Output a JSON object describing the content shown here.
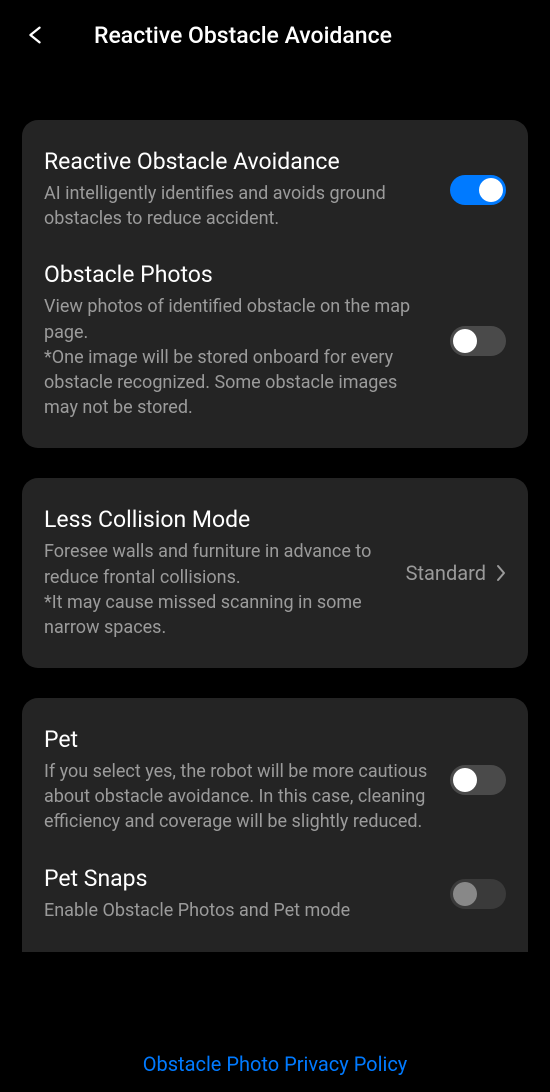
{
  "header": {
    "title": "Reactive Obstacle Avoidance"
  },
  "sections": {
    "reactive": {
      "title": "Reactive Obstacle Avoidance",
      "desc": "AI intelligently identifies and avoids ground obstacles to reduce accident.",
      "enabled": true
    },
    "obstaclePhotos": {
      "title": "Obstacle Photos",
      "desc": "View photos of identified obstacle on the map page.\n*One image will be stored onboard for every obstacle recognized. Some obstacle images may not be stored.",
      "enabled": false
    },
    "lessCollision": {
      "title": "Less Collision Mode",
      "desc": "Foresee walls and furniture in advance to reduce frontal collisions.\n*It may cause missed scanning in some narrow spaces.",
      "value": "Standard"
    },
    "pet": {
      "title": "Pet",
      "desc": "If you select yes, the robot will be more cautious about obstacle avoidance. In this case, cleaning efficiency and coverage will be slightly reduced.",
      "enabled": false
    },
    "petSnaps": {
      "title": "Pet Snaps",
      "desc": "Enable Obstacle Photos and Pet mode"
    }
  },
  "footer": {
    "link": "Obstacle Photo Privacy Policy"
  }
}
